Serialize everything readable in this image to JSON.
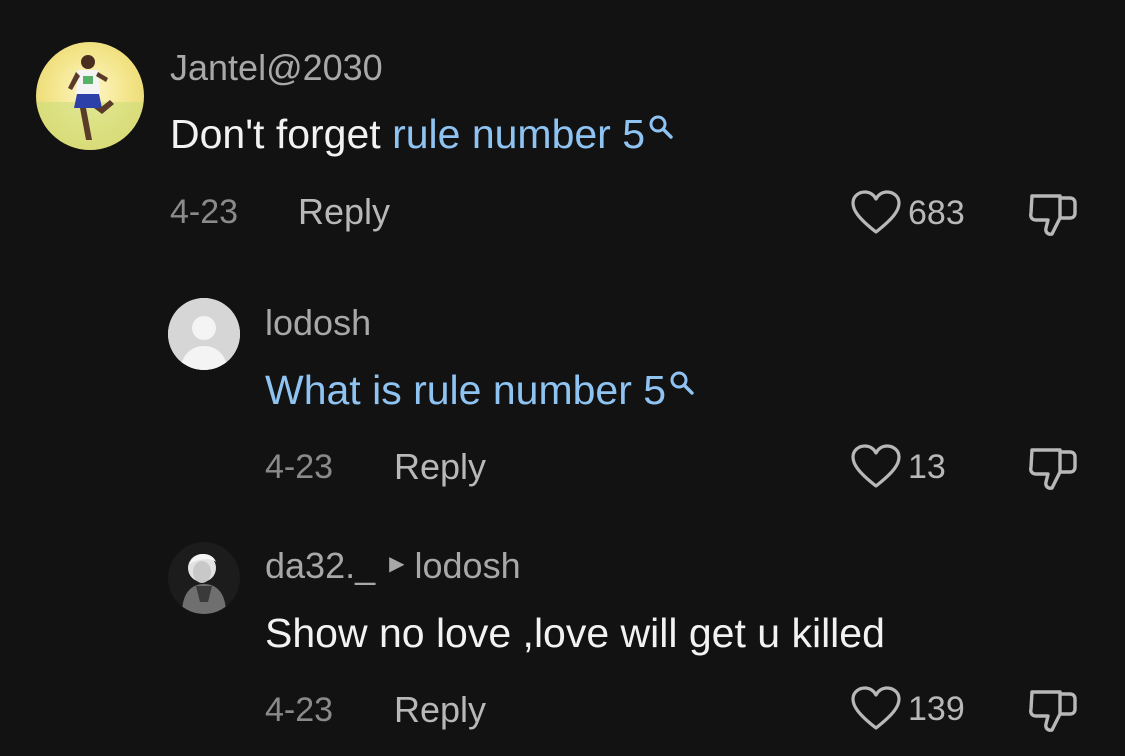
{
  "comments": [
    {
      "username": "Jantel@2030",
      "text_plain": "Don't forget ",
      "text_link": "rule number 5",
      "date": "4-23",
      "reply_label": "Reply",
      "likes": "683"
    },
    {
      "username": "lodosh",
      "text_plain": "",
      "text_link": "What is rule number 5",
      "date": "4-23",
      "reply_label": "Reply",
      "likes": "13"
    },
    {
      "username": "da32._",
      "reply_to": "lodosh",
      "text_plain": "Show no love ,love will get u killed",
      "date": "4-23",
      "reply_label": "Reply",
      "likes": "139"
    }
  ],
  "colors": {
    "background": "#121212",
    "link": "#8fc3f2",
    "username": "#a8a8a8",
    "text": "#f2f2f2"
  },
  "icons": [
    "search-icon",
    "heart-icon",
    "thumbs-down-icon",
    "play-arrow-icon",
    "default-avatar-icon"
  ]
}
